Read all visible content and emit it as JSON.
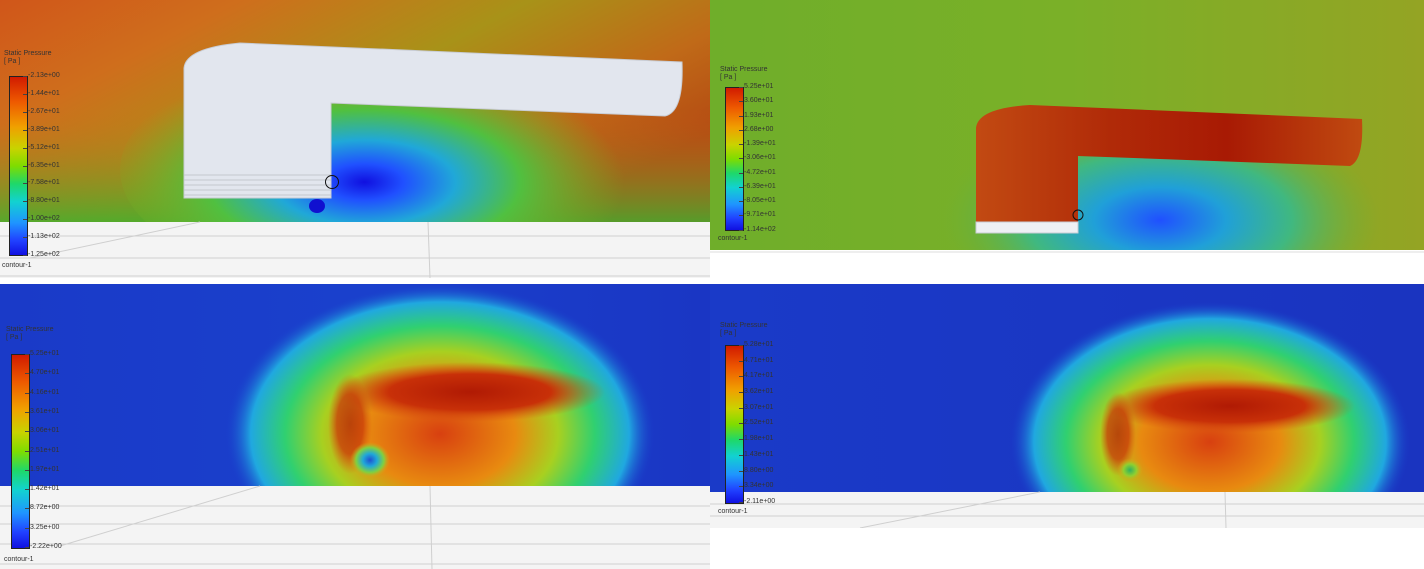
{
  "panels": [
    {
      "title": "Static Pressure",
      "unit": "[ Pa ]",
      "ticks": [
        "-2.13e+00",
        "-1.44e+01",
        "-2.67e+01",
        "-3.89e+01",
        "-5.12e+01",
        "-6.35e+01",
        "-7.58e+01",
        "-8.80e+01",
        "-1.00e+02",
        "-1.13e+02",
        "-1.25e+02"
      ],
      "caption": "contour-1"
    },
    {
      "title": "Static Pressure",
      "unit": "[ Pa ]",
      "ticks": [
        "5.25e+01",
        "3.60e+01",
        "1.93e+01",
        "2.68e+00",
        "-1.39e+01",
        "-3.06e+01",
        "-4.72e+01",
        "-6.39e+01",
        "-8.05e+01",
        "-9.71e+01",
        "-1.14e+02"
      ],
      "caption": "contour-1"
    },
    {
      "title": "Static Pressure",
      "unit": "[ Pa ]",
      "ticks": [
        "5.25e+01",
        "4.70e+01",
        "4.16e+01",
        "3.61e+01",
        "3.06e+01",
        "2.51e+01",
        "1.97e+01",
        "1.42e+01",
        "8.72e+00",
        "3.25e+00",
        "-2.22e+00"
      ],
      "caption": "contour-1"
    },
    {
      "title": "Static Pressure",
      "unit": "[ Pa ]",
      "ticks": [
        "5.28e+01",
        "4.71e+01",
        "4.17e+01",
        "3.62e+01",
        "3.07e+01",
        "2.52e+01",
        "1.98e+01",
        "1.43e+01",
        "8.80e+00",
        "3.34e+00",
        "-2.11e+00"
      ],
      "caption": "contour-1"
    }
  ]
}
